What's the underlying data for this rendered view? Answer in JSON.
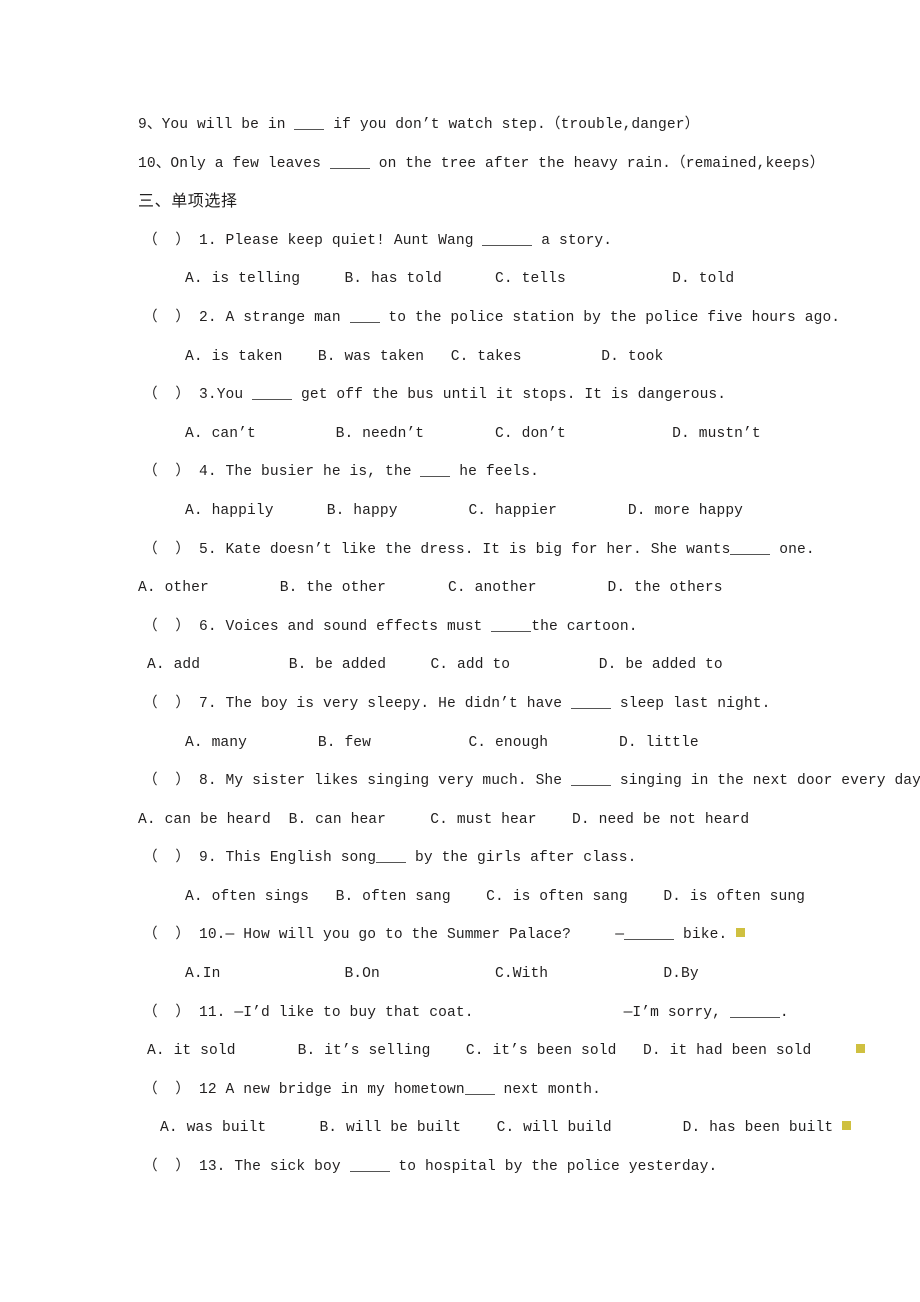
{
  "document": {
    "section_heading": "三、单项选择",
    "fill_in_items": [
      {
        "number": "9、",
        "before": "You will be in ",
        "after": " if you don’t watch step.（trouble,danger）",
        "blank": "b-sm"
      },
      {
        "number": "10、",
        "before": "Only a few leaves ",
        "after": " on the tree after the heavy rain.（remained,keeps）",
        "blank": "b-md"
      }
    ],
    "choice_items": [
      {
        "marker": "（  ）",
        "number": "1.",
        "stem_before": " Please keep quiet! Aunt Wang ",
        "blank": "b-lg",
        "stem_after": " a story.",
        "answer_indent": "ind-a",
        "answers": "A. is telling     B. has told      C. tells            D. told",
        "trailing_marker": false,
        "answers_trailing_marker": false
      },
      {
        "marker": "（  ）",
        "number": "2.",
        "stem_before": " A strange man ",
        "blank": "b-sm",
        "stem_after": " to the police station by the police five hours ago.",
        "answer_indent": "ind-a",
        "answers": "A. is taken    B. was taken   C. takes         D. took",
        "trailing_marker": false,
        "answers_trailing_marker": false
      },
      {
        "marker": "（  ）",
        "number": "3.",
        "stem_before": "You ",
        "blank": "b-md",
        "stem_after": " get off the bus until it stops. It is dangerous.",
        "answer_indent": "ind-a",
        "answers": "A. can’t         B. needn’t        C. don’t            D. mustn’t",
        "trailing_marker": false,
        "answers_trailing_marker": false
      },
      {
        "marker": "（  ）",
        "number": "4.",
        "stem_before": " The busier he is, the ",
        "blank": "b-sm",
        "stem_after": " he feels.",
        "answer_indent": "ind-a",
        "answers": "A. happily      B. happy        C. happier        D. more happy",
        "trailing_marker": false,
        "answers_trailing_marker": false
      },
      {
        "marker": "（  ）",
        "number": "5.",
        "stem_before": " Kate doesn’t like the dress. It is big for her. She wants",
        "blank": "b-md",
        "stem_after": " one.",
        "answer_indent": "ind-0",
        "answers": "A. other        B. the other       C. another        D. the others",
        "trailing_marker": false,
        "answers_trailing_marker": false
      },
      {
        "marker": "（  ）",
        "number": "6.",
        "stem_before": " Voices and sound effects must ",
        "blank": "b-md",
        "stem_after": "the cartoon.",
        "answer_indent": "ind-a2",
        "answers": "A. add          B. be added     C. add to          D. be added to",
        "trailing_marker": false,
        "answers_trailing_marker": false
      },
      {
        "marker": "（  ）",
        "number": "7.",
        "stem_before": " The boy is very sleepy. He didn’t have ",
        "blank": "b-md",
        "stem_after": " sleep last night.",
        "answer_indent": "ind-a",
        "answers": "A. many        B. few           C. enough        D. little",
        "trailing_marker": false,
        "answers_trailing_marker": false
      },
      {
        "marker": "（  ）",
        "number": "8.",
        "stem_before": " My sister likes singing very much. She ",
        "blank": "b-md",
        "stem_after": " singing in the next door every day.",
        "answer_indent": "ind-0",
        "answers": "A. can be heard  B. can hear     C. must hear    D. need be not heard",
        "trailing_marker": false,
        "answers_trailing_marker": false
      },
      {
        "marker": "（  ）",
        "number": "9.",
        "stem_before": " This English song",
        "blank": "b-sm",
        "stem_after": " by the girls after class.",
        "answer_indent": "ind-a",
        "answers": "A. often sings   B. often sang    C. is often sang    D. is often sung",
        "trailing_marker": false,
        "answers_trailing_marker": false
      },
      {
        "marker": "（  ）",
        "number": "10.",
        "stem_before": "— How will you go to the Summer Palace?     —",
        "blank": "b-lg",
        "stem_after": " bike. ",
        "answer_indent": "ind-a",
        "answers": "A.In              B.On             C.With             D.By",
        "trailing_marker": true,
        "answers_trailing_marker": false
      },
      {
        "marker": "（  ）",
        "number": "11.",
        "stem_before": " —I’d like to buy that coat.",
        "stem_gap": true,
        "stem_mid": "—I’m sorry, ",
        "blank": "b-lg",
        "stem_after": ".",
        "answer_indent": "ind-a2",
        "answers": "A. it sold       B. it’s selling    C. it’s been sold   D. it had been sold     ",
        "trailing_marker": false,
        "answers_trailing_marker": true
      },
      {
        "marker": "（  ）",
        "number": "12",
        "stem_before": " A new bridge in my hometown",
        "blank": "b-sm",
        "stem_after": " next month.",
        "answer_indent": "ind-a3",
        "answers": "A. was built      B. will be built    C. will build        D. has been built ",
        "trailing_marker": false,
        "answers_trailing_marker": true
      },
      {
        "marker": "（  ）",
        "number": "13.",
        "stem_before": " The sick boy ",
        "blank": "b-md",
        "stem_after": " to hospital by the police yesterday.",
        "answers": null,
        "trailing_marker": false,
        "answers_trailing_marker": false
      }
    ]
  },
  "colors": {
    "text": "#211f1f",
    "marker_yellow": "#cfc040",
    "background": "#ffffff"
  }
}
